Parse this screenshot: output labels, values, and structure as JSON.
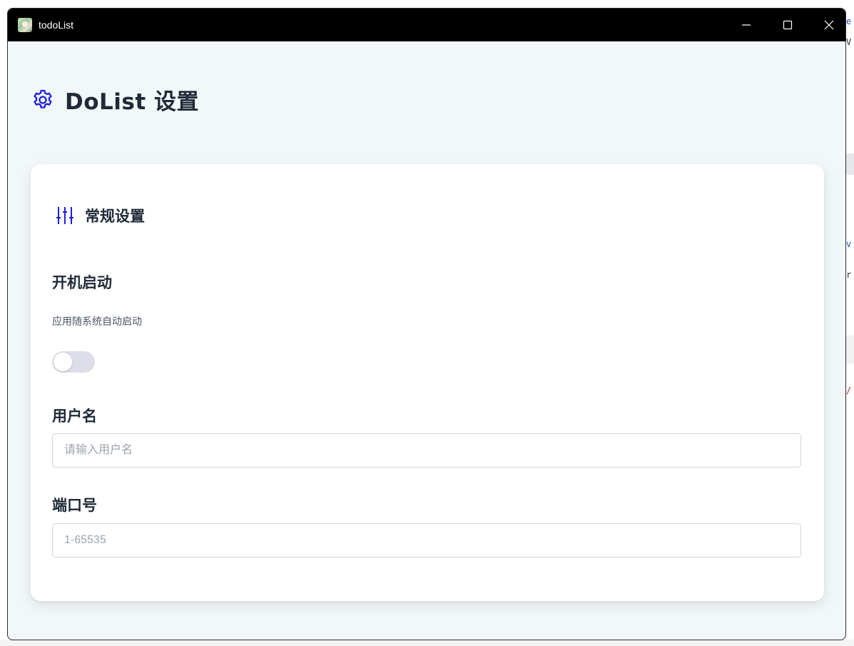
{
  "window": {
    "title": "todoList"
  },
  "header": {
    "title": "DoList 设置",
    "icon": "gear-icon"
  },
  "general": {
    "section_title": "常规设置",
    "section_icon": "sliders-icon",
    "autostart": {
      "label": "开机启动",
      "description": "应用随系统自动启动",
      "enabled": false
    },
    "username": {
      "label": "用户名",
      "placeholder": "请输入用户名",
      "value": ""
    },
    "port": {
      "label": "端口号",
      "placeholder": "1-65535",
      "value": ""
    }
  },
  "colors": {
    "accent": "#1d1de0",
    "titlebar": "#000000",
    "window_bg": "#f2f8f9",
    "card_bg": "#ffffff",
    "toggle_off": "#dcdde6"
  }
}
